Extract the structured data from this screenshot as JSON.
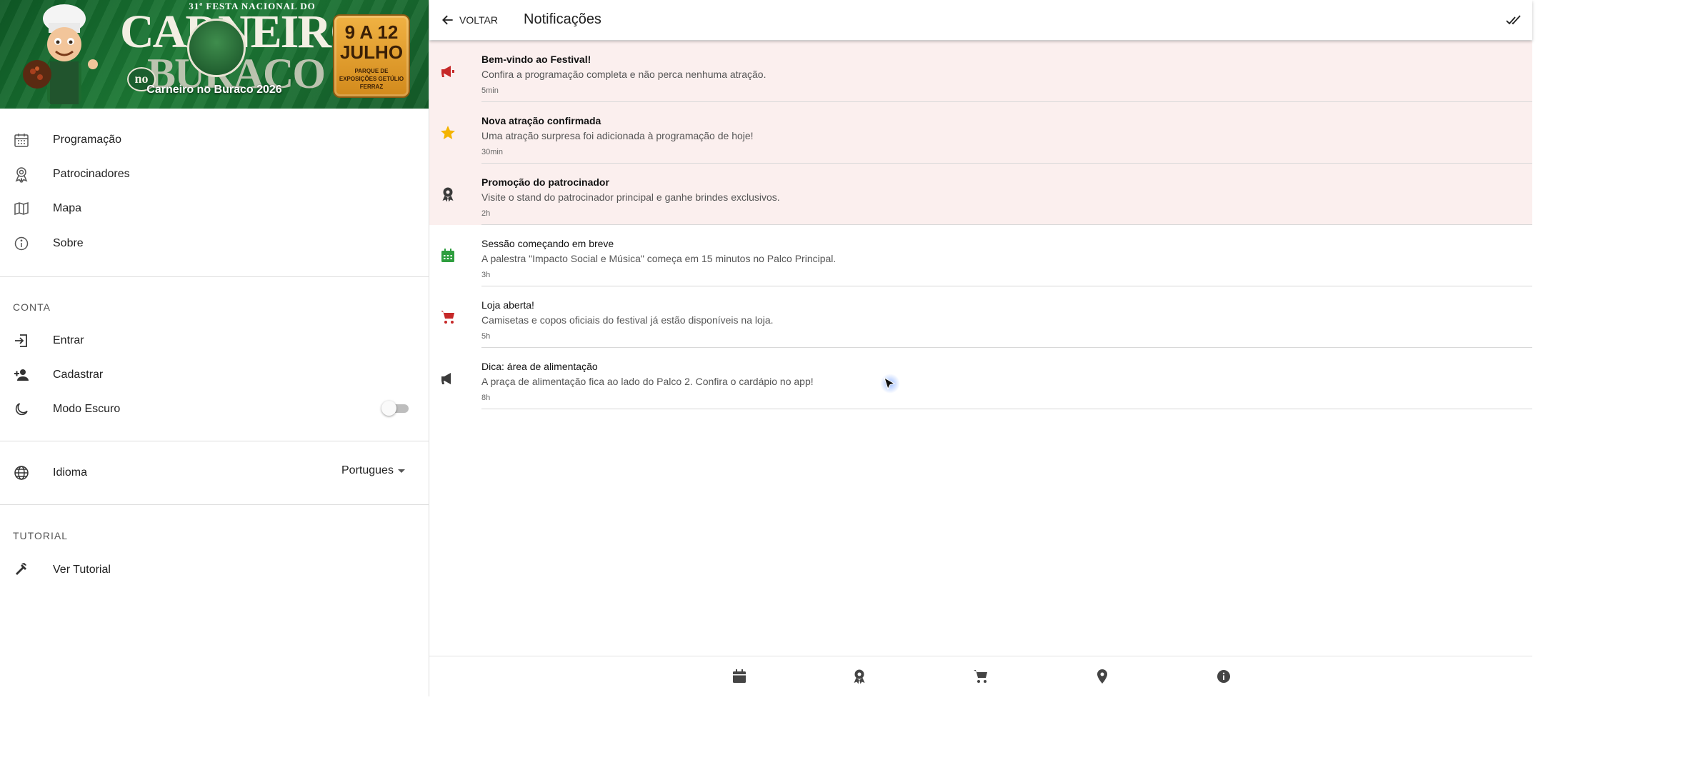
{
  "sidebar": {
    "banner": {
      "fest_title": "31ª FESTA NACIONAL DO",
      "big_word_top": "CARNEIRO",
      "big_word_no": "no",
      "big_word_bottom": "BURACO",
      "date_line1": "9 A 12",
      "date_line2": "JULHO",
      "date_venue": "PARQUE DE EXPOSIÇÕES GETÚLIO FERRAZ",
      "app_name": "Carneiro no Buraco 2026"
    },
    "menu": [
      {
        "label": "Programação",
        "icon": "calendar-icon"
      },
      {
        "label": "Patrocinadores",
        "icon": "award-icon"
      },
      {
        "label": "Mapa",
        "icon": "map-icon"
      },
      {
        "label": "Sobre",
        "icon": "info-icon"
      }
    ],
    "account": {
      "section_title": "CONTA",
      "items": [
        {
          "label": "Entrar",
          "icon": "login-icon"
        },
        {
          "label": "Cadastrar",
          "icon": "person-add-icon"
        },
        {
          "label": "Modo Escuro",
          "icon": "moon-icon"
        }
      ],
      "dark_mode_on": false
    },
    "language": {
      "label": "Idioma",
      "icon": "globe-icon",
      "selected": "Portugues"
    },
    "tutorial": {
      "section_title": "TUTORIAL",
      "item": {
        "label": "Ver Tutorial",
        "icon": "hammer-icon"
      }
    }
  },
  "header": {
    "back_label": "VOLTAR",
    "title": "Notificações",
    "mark_all_icon": "double-check-icon"
  },
  "notifications": [
    {
      "title": "Bem-vindo ao Festival!",
      "body": "Confira a programação completa e não perca nenhuma atração.",
      "time": "5min",
      "unread": true,
      "icon": "megaphone-icon",
      "icon_color": "#c62828"
    },
    {
      "title": "Nova atração confirmada",
      "body": "Uma atração surpresa foi adicionada à programação de hoje!",
      "time": "30min",
      "unread": true,
      "icon": "star-icon",
      "icon_color": "#f4b400"
    },
    {
      "title": "Promoção do patrocinador",
      "body": "Visite o stand do patrocinador principal e ganhe brindes exclusivos.",
      "time": "2h",
      "unread": true,
      "icon": "award-icon",
      "icon_color": "#3a3a3a"
    },
    {
      "title": "Sessão começando em breve",
      "body": "A palestra \"Impacto Social e Música\" começa em 15 minutos no Palco Principal.",
      "time": "3h",
      "unread": false,
      "icon": "calendar-icon",
      "icon_color": "#2e9e3e"
    },
    {
      "title": "Loja aberta!",
      "body": "Camisetas e copos oficiais do festival já estão disponíveis na loja.",
      "time": "5h",
      "unread": false,
      "icon": "cart-icon",
      "icon_color": "#c62828"
    },
    {
      "title": "Dica: área de alimentação",
      "body": "A praça de alimentação fica ao lado do Palco 2. Confira o cardápio no app!",
      "time": "8h",
      "unread": false,
      "icon": "megaphone-icon",
      "icon_color": "#3a3a3a"
    }
  ],
  "bottom_nav": [
    {
      "icon": "calendar-icon"
    },
    {
      "icon": "award-icon"
    },
    {
      "icon": "cart-icon"
    },
    {
      "icon": "location-pin-icon"
    },
    {
      "icon": "info-icon"
    }
  ],
  "colors": {
    "unread_bg": "#fbefee",
    "banner_green": "#1c7a35",
    "date_gold": "#f0b243"
  }
}
